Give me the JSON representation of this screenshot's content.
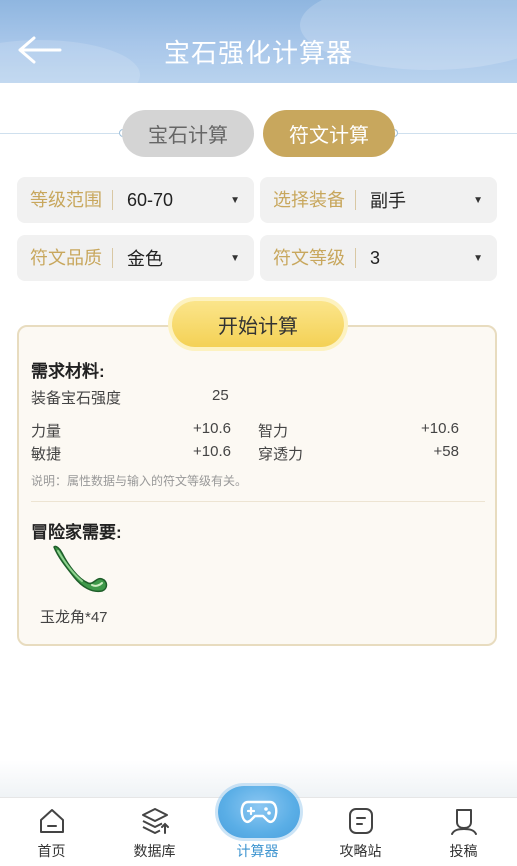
{
  "header": {
    "title": "宝石强化计算器",
    "back_icon": "arrow-left-icon"
  },
  "tabs": [
    {
      "label": "宝石计算",
      "active": false
    },
    {
      "label": "符文计算",
      "active": true
    }
  ],
  "selects": {
    "level_range": {
      "label": "等级范围",
      "value": "60-70"
    },
    "equipment": {
      "label": "选择装备",
      "value": "副手"
    },
    "rune_quality": {
      "label": "符文品质",
      "value": "金色"
    },
    "rune_level": {
      "label": "符文等级",
      "value": "3"
    }
  },
  "calc_button": {
    "label": "开始计算"
  },
  "result": {
    "materials_title": "需求材料:",
    "gem_strength": {
      "label": "装备宝石强度",
      "value": "25"
    },
    "stats": [
      {
        "label": "力量",
        "value": "+10.6"
      },
      {
        "label": "智力",
        "value": "+10.6"
      },
      {
        "label": "敏捷",
        "value": "+10.6"
      },
      {
        "label": "穿透力",
        "value": "+58"
      }
    ],
    "note": "说明：属性数据与输入的符文等级有关。",
    "adventurer_title": "冒险家需要:",
    "item": {
      "label": "玉龙角*47",
      "icon": "jade-horn-icon"
    }
  },
  "nav": [
    {
      "label": "首页",
      "icon": "home-icon",
      "active": false
    },
    {
      "label": "数据库",
      "icon": "database-icon",
      "active": false
    },
    {
      "label": "计算器",
      "icon": "gamepad-icon",
      "active": true
    },
    {
      "label": "攻略站",
      "icon": "guide-icon",
      "active": false
    },
    {
      "label": "投稿",
      "icon": "user-icon",
      "active": false
    }
  ],
  "colors": {
    "accent_gold": "#c8a75d",
    "nav_active": "#3f95d0",
    "header_blue": "#a9c7ea"
  }
}
